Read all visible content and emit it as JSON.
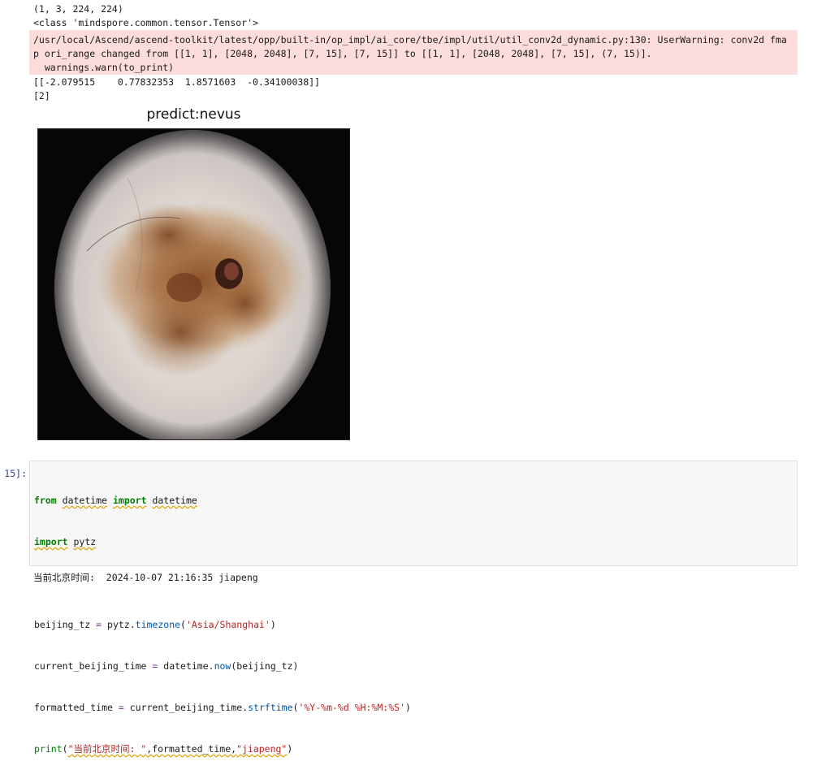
{
  "outputs": {
    "line1": "(1, 3, 224, 224)",
    "line2": "<class 'mindspore.common.tensor.Tensor'>",
    "stderr": [
      "/usr/local/Ascend/ascend-toolkit/latest/opp/built-in/op_impl/ai_core/tbe/impl/util/util_conv2d_dynamic.py:130: UserWarning: conv2d fma",
      "p ori_range changed from [[1, 1], [2048, 2048], [7, 15], [7, 15]] to [[1, 1], [2048, 2048], [7, 15], (7, 15)].",
      "  warnings.warn(to_print)"
    ],
    "logits": "[[-2.079515    0.77832353  1.8571603  -0.34100038]]",
    "pred_index": "[2]"
  },
  "figure": {
    "title": "predict:nevus"
  },
  "cell": {
    "prompt": "15]:",
    "code": {
      "l1_from": "from",
      "l1_mod": "datetime",
      "l1_import": "import",
      "l1_name": "datetime",
      "l2_import": "import",
      "l2_mod": "pytz",
      "l4_var": "beijing_tz",
      "l4_eq": " = ",
      "l4_obj": "pytz.",
      "l4_fn": "timezone",
      "l4_open": "(",
      "l4_str": "'Asia/Shanghai'",
      "l4_close": ")",
      "l5_var": "current_beijing_time",
      "l5_eq": " = ",
      "l5_obj": "datetime.",
      "l5_fn": "now",
      "l5_args": "(beijing_tz)",
      "l6_var": "formatted_time",
      "l6_eq": " = ",
      "l6_obj": "current_beijing_time.",
      "l6_fn": "strftime",
      "l6_open": "(",
      "l6_str": "'%Y-%m-%d %H:%M:%S'",
      "l6_close": ")",
      "l7_fn": "print",
      "l7_open": "(",
      "l7_str1": "\"当前北京时间: \"",
      "l7_mid": ",formatted_time,",
      "l7_str2": "\"jiapeng\"",
      "l7_close": ")"
    },
    "output": "当前北京时间:  2024-10-07 21:16:35 jiapeng"
  },
  "colors": {
    "stderr_bg": "#fddcdc",
    "keyword": "#008000",
    "string": "#ba2121",
    "prompt": "#303f9f"
  }
}
